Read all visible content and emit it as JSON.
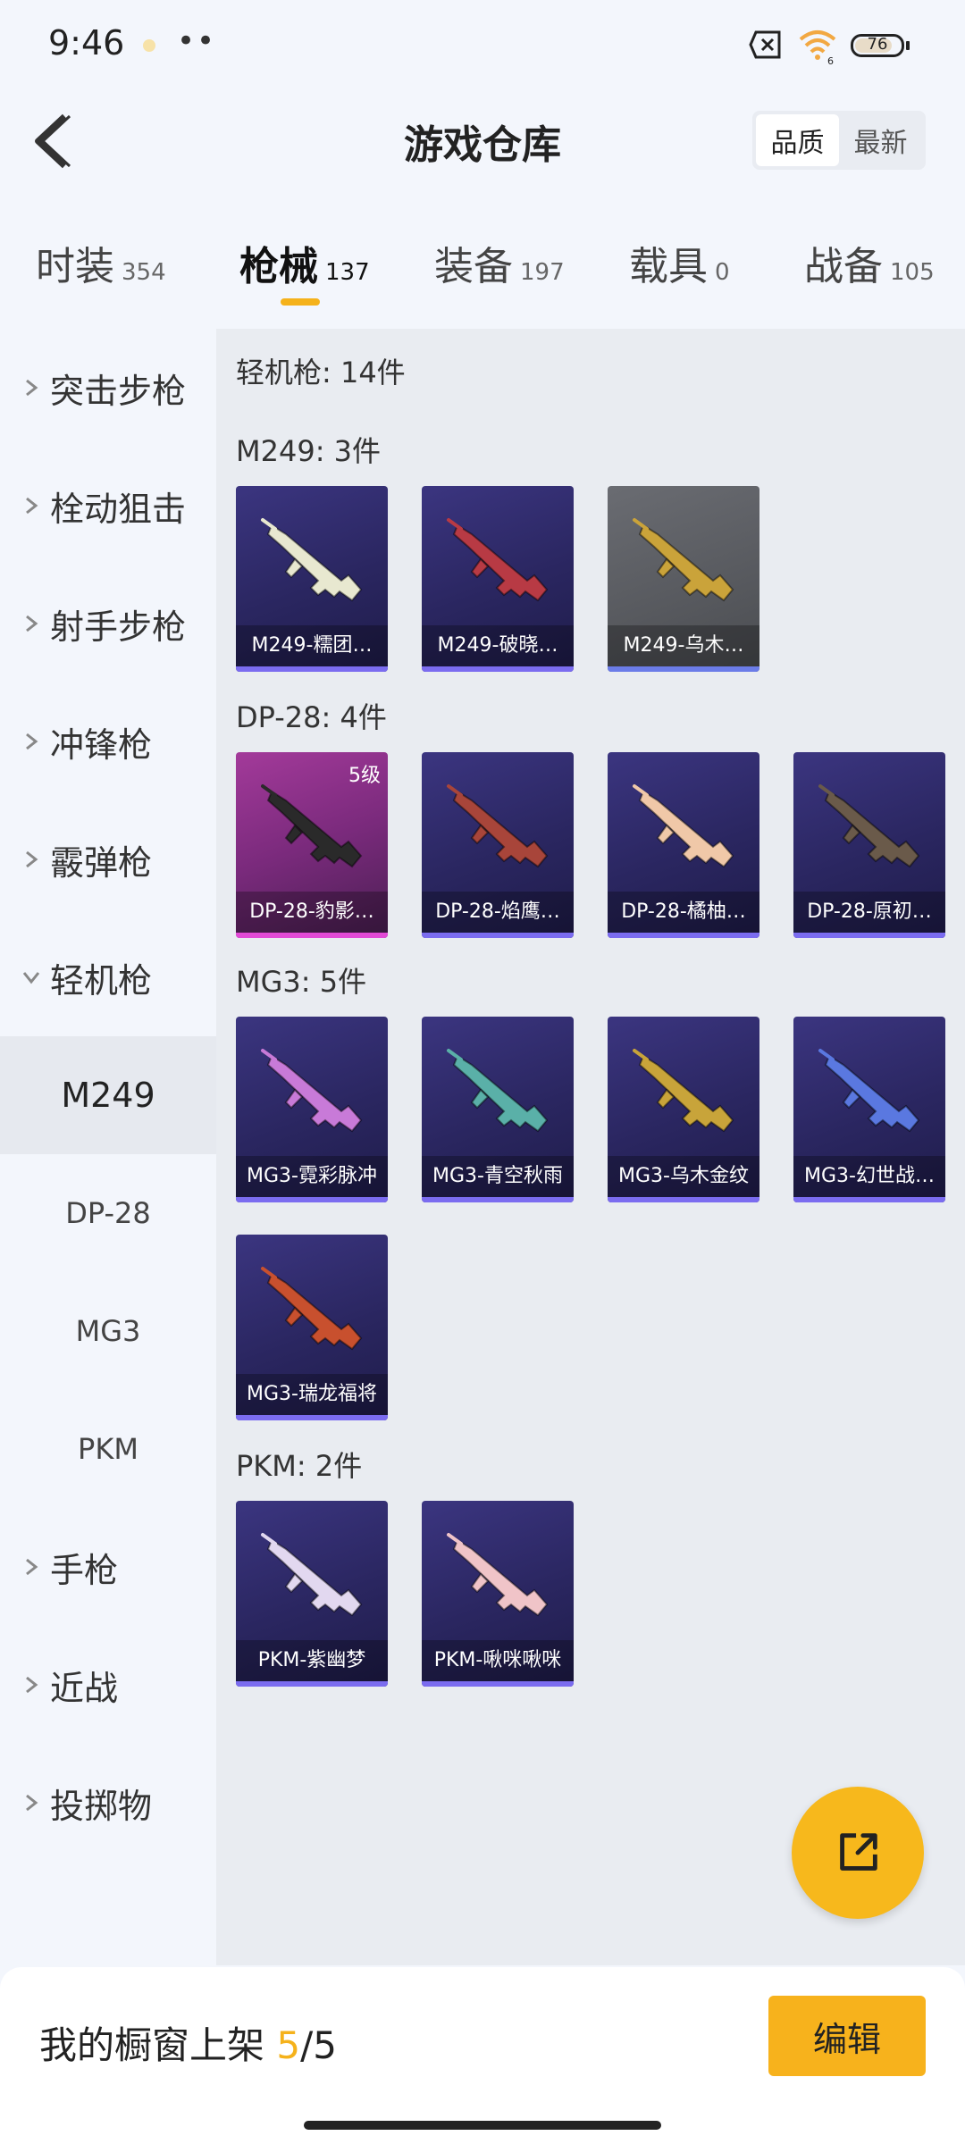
{
  "status": {
    "time": "9:46",
    "more": "••",
    "battery": "76",
    "signal": "6"
  },
  "header": {
    "title": "游戏仓库",
    "sort": [
      "品质",
      "最新"
    ]
  },
  "tabs": [
    {
      "label": "时装",
      "count": "354"
    },
    {
      "label": "枪械",
      "count": "137"
    },
    {
      "label": "装备",
      "count": "197"
    },
    {
      "label": "载具",
      "count": "0"
    },
    {
      "label": "战备",
      "count": "105"
    }
  ],
  "sidebar": {
    "categories": [
      "突击步枪",
      "栓动狙击",
      "射手步枪",
      "冲锋枪",
      "霰弹枪",
      "轻机枪"
    ],
    "subs": [
      "M249",
      "DP-28",
      "MG3",
      "PKM"
    ],
    "after": [
      "手枪",
      "近战",
      "投掷物"
    ]
  },
  "content": {
    "summary": "轻机枪: 14件",
    "groups": [
      {
        "title": "M249: 3件",
        "items": [
          {
            "name": "M249-糯团…",
            "style": "purple",
            "tint": "#e8e8d0"
          },
          {
            "name": "M249-破晓…",
            "style": "purple",
            "tint": "#b83a44"
          },
          {
            "name": "M249-乌木…",
            "style": "gray",
            "tint": "#caa33a"
          }
        ]
      },
      {
        "title": "DP-28: 4件",
        "items": [
          {
            "name": "DP-28-豹影…",
            "style": "pink",
            "tint": "#2a2a2a",
            "badge": "5级"
          },
          {
            "name": "DP-28-焰鹰…",
            "style": "purple",
            "tint": "#a8453a"
          },
          {
            "name": "DP-28-橘柚…",
            "style": "purple",
            "tint": "#f0c8a8"
          },
          {
            "name": "DP-28-原初…",
            "style": "purple",
            "tint": "#6a5a4a"
          }
        ]
      },
      {
        "title": "MG3: 5件",
        "items": [
          {
            "name": "MG3-霓彩脉冲",
            "style": "purple",
            "tint": "#c87ad8"
          },
          {
            "name": "MG3-青空秋雨",
            "style": "purple",
            "tint": "#5ab0a8"
          },
          {
            "name": "MG3-乌木金纹",
            "style": "purple",
            "tint": "#c8a43a"
          },
          {
            "name": "MG3-幻世战…",
            "style": "purple",
            "tint": "#5a78e0"
          },
          {
            "name": "MG3-瑞龙福将",
            "style": "purple",
            "tint": "#c8502e"
          }
        ]
      },
      {
        "title": "PKM: 2件",
        "items": [
          {
            "name": "PKM-紫幽梦",
            "style": "purple",
            "tint": "#e2d8f0"
          },
          {
            "name": "PKM-啾咪啾咪",
            "style": "purple",
            "tint": "#f0c4c8"
          }
        ]
      }
    ]
  },
  "bottom": {
    "label": "我的橱窗上架 ",
    "current": "5",
    "total": "/5",
    "edit": "编辑"
  },
  "colors": {
    "accent": "#f5b21b",
    "card": "#2a2660"
  }
}
